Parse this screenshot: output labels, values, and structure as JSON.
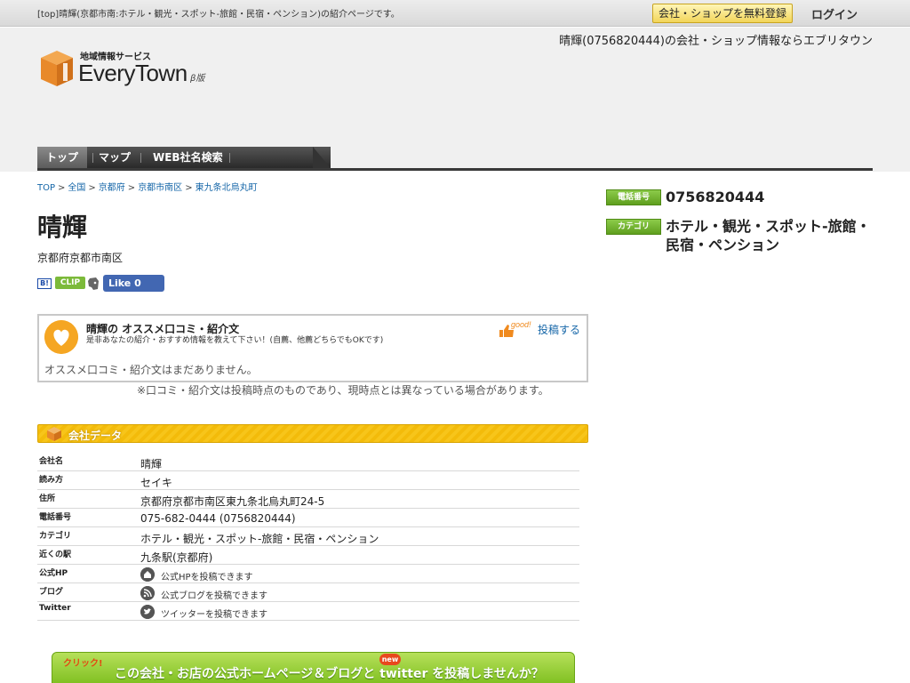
{
  "topbar": {
    "description": "[top]晴輝(京都市南:ホテル・観光・スポット-旅館・民宿・ペンション)の紹介ページです。",
    "register_button": "会社・ショップを無料登録",
    "login": "ログイン"
  },
  "header": {
    "tagline": "晴輝(0756820444)の会社・ショップ情報ならエブリタウン",
    "logo_sub": "地域情報サービス",
    "logo_main": "EveryTown",
    "logo_beta": "β版",
    "nav": [
      "トップ",
      "マップ",
      "WEB社名検索"
    ]
  },
  "breadcrumb": [
    "TOP",
    "全国",
    "京都府",
    "京都市南区",
    "東九条北烏丸町"
  ],
  "business": {
    "name": "晴輝",
    "region": "京都府京都市南区"
  },
  "social": {
    "hatena": "B!",
    "clip": "CLIP",
    "fb_like": "Like 0"
  },
  "review": {
    "title": "晴輝の オススメ口コミ・紹介文",
    "subtitle": "是非あなたの紹介・おすすめ情報を教えて下さい！(自薦、他薦どちらでもOKです)",
    "good": "good!",
    "post_link": "投稿する",
    "empty": "オススメ口コミ・紹介文はまだありません。",
    "note": "※口コミ・紹介文は投稿時点のものであり、現時点とは異なっている場合があります。"
  },
  "company": {
    "section_title": "会社データ",
    "rows": [
      {
        "key": "会社名",
        "value": "晴輝"
      },
      {
        "key": "読み方",
        "value": "セイキ"
      },
      {
        "key": "住所",
        "value": "京都府京都市南区東九条北烏丸町24-5"
      },
      {
        "key": "電話番号",
        "value": "075-682-0444 (0756820444)"
      },
      {
        "key": "カテゴリ",
        "value": "ホテル・観光・スポット-旅館・民宿・ペンション"
      },
      {
        "key": "近くの駅",
        "value": "九条駅(京都府)"
      },
      {
        "key": "公式HP",
        "value": "公式HPを投稿できます"
      },
      {
        "key": "ブログ",
        "value": "公式ブログを投稿できます"
      },
      {
        "key": "Twitter",
        "value": "ツイッターを投稿できます"
      }
    ]
  },
  "banner": {
    "click": "クリック!",
    "new": "new",
    "text": "この会社・お店の公式ホームページ＆ブログと twitter を投稿しませんか？"
  },
  "sidebar": {
    "phone_label": "電話番号",
    "phone": "0756820444",
    "category_label": "カテゴリ",
    "category": "ホテル・観光・スポット-旅館・民宿・ペンション"
  },
  "colors": {
    "accent_green": "#7cba3a",
    "section_yellow": "#f7c51a",
    "link_blue": "#1566a8",
    "logo_orange": "#e8892a"
  }
}
